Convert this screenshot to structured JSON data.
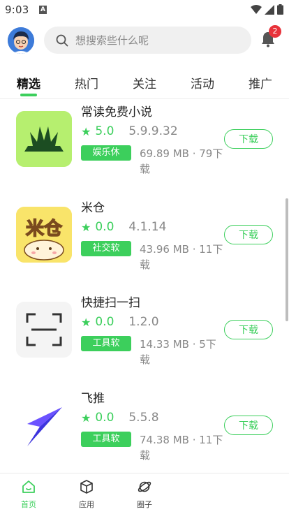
{
  "status_bar": {
    "time": "9:03",
    "notification_letter": "A"
  },
  "header": {
    "search_placeholder": "想搜索些什么呢",
    "notification_count": "2"
  },
  "tabs": [
    {
      "label": "精选",
      "active": true
    },
    {
      "label": "热门",
      "active": false
    },
    {
      "label": "关注",
      "active": false
    },
    {
      "label": "活动",
      "active": false
    },
    {
      "label": "推广",
      "active": false
    }
  ],
  "apps": [
    {
      "name": "常读免费小说",
      "rating": "5.0",
      "version": "5.9.9.32",
      "tag": "娱乐休",
      "size": "69.89 MB · 79下载",
      "download_label": "下载"
    },
    {
      "name": "米仓",
      "rating": "0.0",
      "version": "4.1.14",
      "tag": "社交软",
      "size": "43.96 MB · 11下载",
      "download_label": "下载"
    },
    {
      "name": "快捷扫一扫",
      "rating": "0.0",
      "version": "1.2.0",
      "tag": "工具软",
      "size": "14.33 MB · 5下载",
      "download_label": "下载"
    },
    {
      "name": "飞推",
      "rating": "0.0",
      "version": "5.5.8",
      "tag": "工具软",
      "size": "74.38 MB · 11下载",
      "download_label": "下载"
    }
  ],
  "bottom_nav": [
    {
      "label": "首页",
      "icon": "home-icon",
      "active": true
    },
    {
      "label": "应用",
      "icon": "cube-icon",
      "active": false
    },
    {
      "label": "圈子",
      "icon": "planet-icon",
      "active": false
    }
  ],
  "colors": {
    "accent": "#3ccf5c",
    "badge": "#e8323a"
  }
}
